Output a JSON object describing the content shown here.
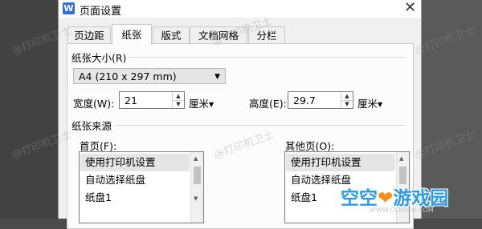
{
  "window": {
    "title": "页面设置",
    "app_icon_letter": "W"
  },
  "tabs": [
    {
      "label": "页边距",
      "active": false
    },
    {
      "label": "纸张",
      "active": true
    },
    {
      "label": "版式",
      "active": false
    },
    {
      "label": "文档网格",
      "active": false
    },
    {
      "label": "分栏",
      "active": false
    }
  ],
  "paper_size": {
    "group_label": "纸张大小(R)",
    "selected": "A4 (210 x 297 mm)",
    "width_label": "宽度(W):",
    "width_value": "21",
    "width_unit": "厘米",
    "height_label": "高度(E):",
    "height_value": "29.7",
    "height_unit": "厘米"
  },
  "paper_source": {
    "group_label": "纸张来源",
    "first_page_label": "首页(F):",
    "first_page_items": [
      "使用打印机设置",
      "自动选择纸盘",
      "纸盘1"
    ],
    "other_pages_label": "其他页(O):",
    "other_pages_items": [
      "使用打印机设置",
      "自动选择纸盘",
      "纸盘1"
    ]
  },
  "watermarks": {
    "text": "@打印机卫士"
  },
  "branding": {
    "name_part1": "空空",
    "heart": "❤",
    "name_part2": "游戏园",
    "url": "WWW.CCKOKO.COM"
  },
  "colors": {
    "brand_blue": "#2b9be6",
    "brand_orange": "#ff8c1a",
    "app_icon_blue": "#2f6fd6"
  }
}
